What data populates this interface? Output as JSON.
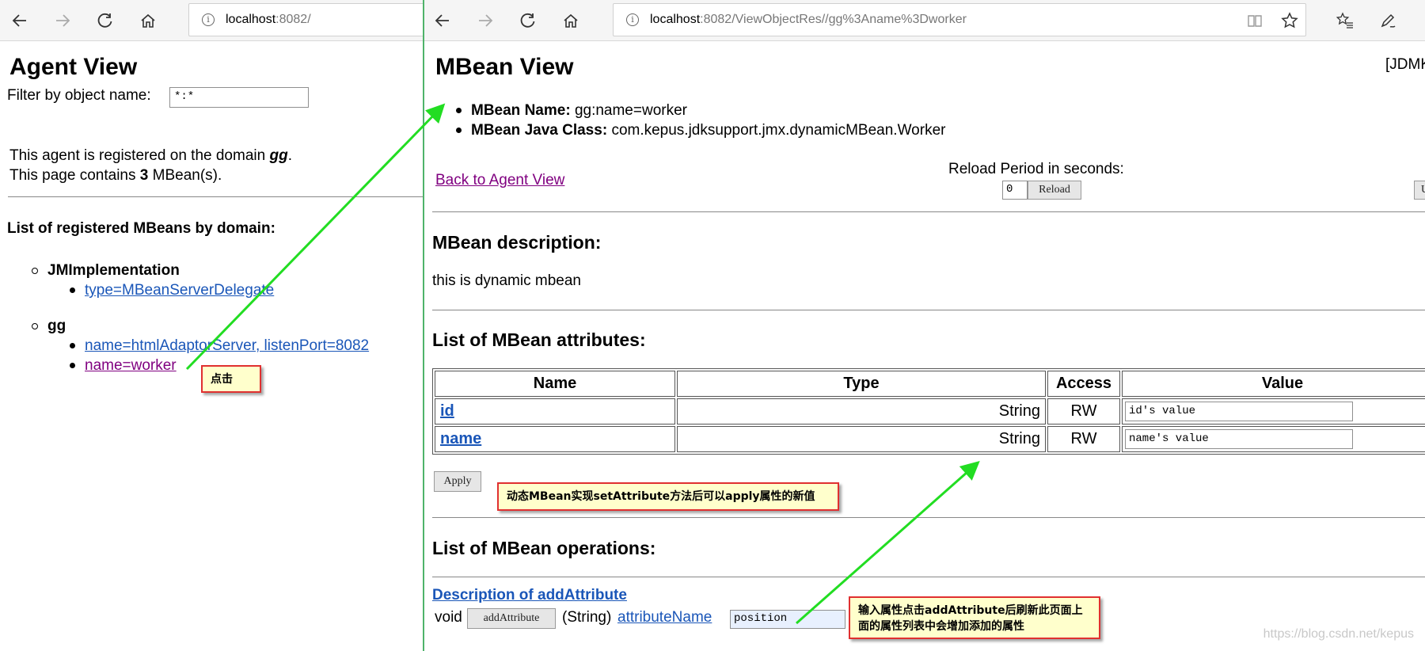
{
  "left_window": {
    "address": {
      "host": "localhost",
      "path": ":8082/"
    },
    "title": "Agent View",
    "filter_label": "Filter by object name:",
    "filter_value": "*:*",
    "domain_line_prefix": "This agent is registered on the domain ",
    "domain_name": "gg",
    "domain_line_suffix": ".",
    "count_line_prefix": "This page contains ",
    "count_value": "3",
    "count_line_suffix": " MBean(s).",
    "list_heading": "List of registered MBeans by domain:",
    "domains": [
      {
        "name": "JMImplementation",
        "mbeans": [
          "type=MBeanServerDelegate"
        ]
      },
      {
        "name": "gg",
        "mbeans": [
          "name=htmlAdaptorServer, listenPort=8082",
          "name=worker"
        ]
      }
    ]
  },
  "right_window": {
    "address": {
      "host": "localhost",
      "path": ":8082/ViewObjectRes//gg%3Aname%3Dworker"
    },
    "title": "MBean View",
    "corner_text": "[JDMK",
    "mbean_name_label": "MBean Name:",
    "mbean_name_value": "gg:name=worker",
    "mbean_class_label": "MBean Java Class:",
    "mbean_class_value": "com.kepus.jdksupport.jmx.dynamicMBean.Worker",
    "back_link": "Back to Agent View",
    "reload_label": "Reload Period in seconds:",
    "reload_value": "0",
    "reload_button": "Reload",
    "cut_button": "U",
    "description_heading": "MBean description:",
    "description_text": "this is dynamic mbean",
    "attributes_heading": "List of MBean attributes:",
    "attributes_table": {
      "headers": [
        "Name",
        "Type",
        "Access",
        "Value"
      ],
      "rows": [
        {
          "name": "id",
          "type": "String",
          "access": "RW",
          "value": "id's value"
        },
        {
          "name": "name",
          "type": "String",
          "access": "RW",
          "value": "name's value"
        }
      ]
    },
    "apply_button": "Apply",
    "operations_heading": "List of MBean operations:",
    "operation": {
      "description_link": "Description of addAttribute",
      "return_type": "void",
      "button": "addAttribute",
      "param_type": "(String)",
      "param_name": "attributeName",
      "param_value": "position"
    }
  },
  "annotations": {
    "click_note": "点击",
    "apply_note": "动态MBean实现setAttribute方法后可以apply属性的新值",
    "add_note": "输入属性点击addAttribute后刷新此页面上面的属性列表中会增加添加的属性"
  },
  "watermark": "https://blog.csdn.net/kepus",
  "colors": {
    "link": "#1a56b8",
    "visited_link": "#800080",
    "arrow": "#22dd22",
    "note_border": "#e03030",
    "note_fill": "#ffffcc"
  }
}
